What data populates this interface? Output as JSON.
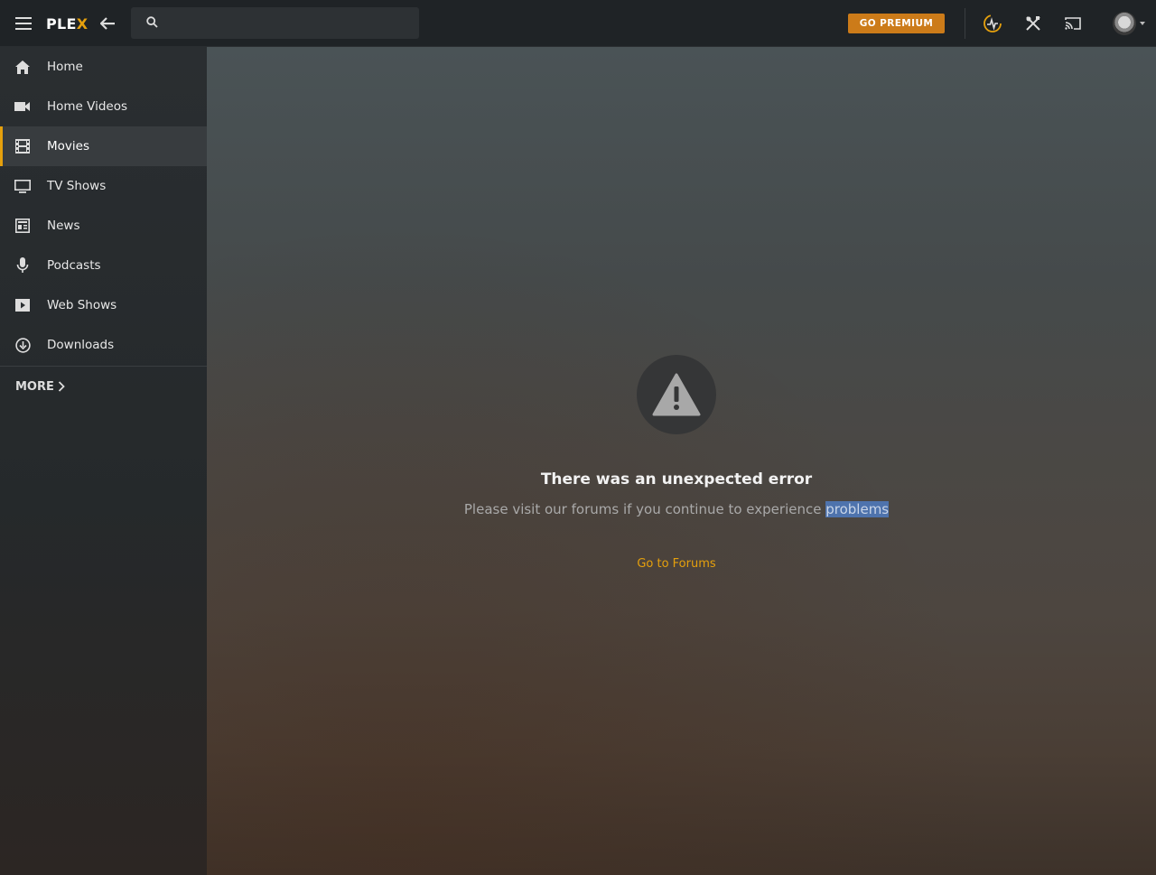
{
  "app": {
    "logo_main": "PLE",
    "logo_accent": "X"
  },
  "topbar": {
    "search_placeholder": "",
    "premium_label": "GO PREMIUM"
  },
  "sidebar": {
    "items": [
      {
        "label": "Home",
        "icon": "home-icon"
      },
      {
        "label": "Home Videos",
        "icon": "video-camera-icon"
      },
      {
        "label": "Movies",
        "icon": "film-icon",
        "active": true
      },
      {
        "label": "TV Shows",
        "icon": "tv-icon"
      },
      {
        "label": "News",
        "icon": "newspaper-icon"
      },
      {
        "label": "Podcasts",
        "icon": "microphone-icon"
      },
      {
        "label": "Web Shows",
        "icon": "play-icon"
      },
      {
        "label": "Downloads",
        "icon": "download-icon"
      }
    ],
    "more_label": "MORE"
  },
  "error": {
    "title": "There was an unexpected error",
    "subtitle_pre": "Please visit our forums if you continue to experience",
    "subtitle_selected": "problems",
    "link_label": "Go to Forums"
  },
  "colors": {
    "accent": "#e5a00d",
    "premium": "#cc7b19",
    "topbar": "#1f2326",
    "selection": "#4e73ad"
  }
}
